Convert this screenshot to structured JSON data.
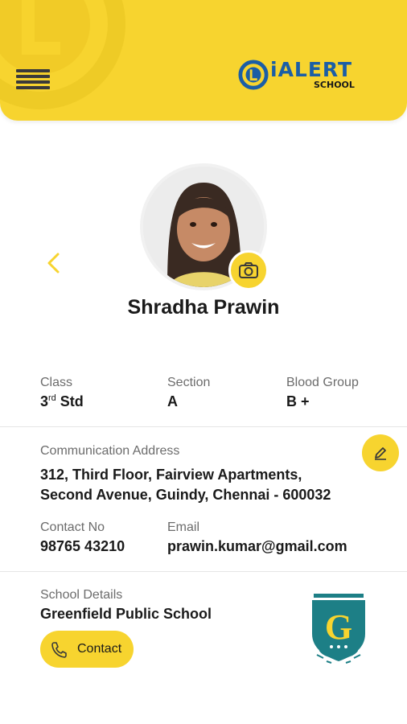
{
  "header": {
    "menu_icon": "hamburger-menu-icon",
    "logo": {
      "main": "iALERT",
      "sub": "SCHOOL"
    }
  },
  "student": {
    "name": "Shradha Prawin",
    "photo_icon": "student-photo",
    "camera_icon": "camera-icon",
    "back_icon": "chevron-left-icon"
  },
  "details": {
    "class_label": "Class",
    "class_value": "3",
    "class_suffix": "rd",
    "class_unit": " Std",
    "section_label": "Section",
    "section_value": "A",
    "blood_label": "Blood Group",
    "blood_value": "B +"
  },
  "address": {
    "label": "Communication Address",
    "line1": "312, Third Floor, Fairview Apartments,",
    "line2": "Second Avenue, Guindy, Chennai - 600032",
    "edit_icon": "pencil-icon"
  },
  "contact": {
    "phone_label": "Contact No",
    "phone_value": "98765 43210",
    "email_label": "Email",
    "email_value": "prawin.kumar@gmail.com"
  },
  "school": {
    "label": "School Details",
    "name": "Greenfield Public School",
    "contact_button": "Contact",
    "crest_letter": "G"
  },
  "colors": {
    "accent": "#f7d42f",
    "brand_blue": "#1b5ea6",
    "crest_teal": "#1d7f86"
  }
}
